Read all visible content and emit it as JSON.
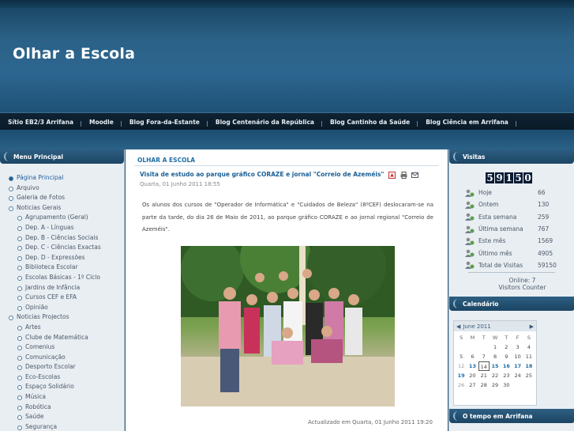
{
  "site": {
    "title": "Olhar a Escola"
  },
  "nav": [
    "Sítio EB2/3 Arrifana",
    "Moodle",
    "Blog Fora-da-Estante",
    "Blog Centenário da República",
    "Blog Cantinho da Saúde",
    "Blog Ciência em Arrifana"
  ],
  "left_menu": {
    "title": "Menu Principal",
    "items": [
      {
        "label": "Página Principal",
        "level": 0,
        "active": true
      },
      {
        "label": "Arquivo",
        "level": 0
      },
      {
        "label": "Galeria de Fotos",
        "level": 0
      },
      {
        "label": "Noticias Gerais",
        "level": 0
      },
      {
        "label": "Agrupamento (Geral)",
        "level": 1
      },
      {
        "label": "Dep. A - Línguas",
        "level": 1
      },
      {
        "label": "Dep. B - Ciências Sociais",
        "level": 1
      },
      {
        "label": "Dep. C - Ciências Exactas",
        "level": 1
      },
      {
        "label": "Dep. D - Expressões",
        "level": 1
      },
      {
        "label": "Biblioteca Escolar",
        "level": 1
      },
      {
        "label": "Escolas Básicas - 1º Ciclo",
        "level": 1
      },
      {
        "label": "Jardins de Infância",
        "level": 1
      },
      {
        "label": "Cursos CEF e EFA",
        "level": 1
      },
      {
        "label": "Opinião",
        "level": 1
      },
      {
        "label": "Noticias Projectos",
        "level": 0
      },
      {
        "label": "Artes",
        "level": 1
      },
      {
        "label": "Clube de Matemática",
        "level": 1
      },
      {
        "label": "Comenius",
        "level": 1
      },
      {
        "label": "Comunicação",
        "level": 1
      },
      {
        "label": "Desporto Escolar",
        "level": 1
      },
      {
        "label": "Eco-Escolas",
        "level": 1
      },
      {
        "label": "Espaço Solidário",
        "level": 1
      },
      {
        "label": "Música",
        "level": 1
      },
      {
        "label": "Robótica",
        "level": 1
      },
      {
        "label": "Saúde",
        "level": 1
      },
      {
        "label": "Segurança",
        "level": 1
      }
    ]
  },
  "main": {
    "section_title": "OLHAR A ESCOLA",
    "article_title": "Visita de estudo ao parque gráfico CORAZE e jornal \"Correio de Azeméis\"",
    "date": "Quarta, 01 Junho 2011 18:55",
    "body": "Os alunos dos cursos de \"Operador de Informática\" e \"Cuidados de Beleza\" (8ºCEF) deslocaram-se na parte da tarde, do dia 26 de Maio de 2011, ao parque gráfico CORAZE e ao jornal regional \"Correio de Azeméis\".",
    "updated": "Actualizado em Quarta, 01 Junho 2011 19:20",
    "icons": [
      "pdf-icon",
      "print-icon",
      "email-icon"
    ]
  },
  "visits": {
    "title": "Visitas",
    "counter_digits": [
      "5",
      "9",
      "1",
      "5",
      "0"
    ],
    "stats": [
      {
        "label": "Hoje",
        "value": "66"
      },
      {
        "label": "Ontem",
        "value": "130"
      },
      {
        "label": "Esta semana",
        "value": "259"
      },
      {
        "label": "Última semana",
        "value": "767"
      },
      {
        "label": "Este mês",
        "value": "1569"
      },
      {
        "label": "Último mês",
        "value": "4905"
      },
      {
        "label": "Total de Visitas",
        "value": "59150"
      }
    ],
    "online": "Online: 7",
    "counter_name": "Visitors Counter"
  },
  "calendar": {
    "title": "Calendário",
    "month": "June 2011",
    "dow": [
      "S",
      "M",
      "T",
      "W",
      "T",
      "F",
      "S"
    ],
    "days": [
      {
        "d": "",
        "c": ""
      },
      {
        "d": "",
        "c": ""
      },
      {
        "d": "",
        "c": ""
      },
      {
        "d": "1",
        "c": ""
      },
      {
        "d": "2",
        "c": ""
      },
      {
        "d": "3",
        "c": ""
      },
      {
        "d": "4",
        "c": ""
      },
      {
        "d": "5",
        "c": ""
      },
      {
        "d": "6",
        "c": ""
      },
      {
        "d": "7",
        "c": ""
      },
      {
        "d": "8",
        "c": ""
      },
      {
        "d": "9",
        "c": ""
      },
      {
        "d": "10",
        "c": ""
      },
      {
        "d": "11",
        "c": ""
      },
      {
        "d": "12",
        "c": "other"
      },
      {
        "d": "13",
        "c": "link"
      },
      {
        "d": "14",
        "c": "today"
      },
      {
        "d": "15",
        "c": "link"
      },
      {
        "d": "16",
        "c": "link"
      },
      {
        "d": "17",
        "c": "link"
      },
      {
        "d": "18",
        "c": "link"
      },
      {
        "d": "19",
        "c": "link"
      },
      {
        "d": "20",
        "c": ""
      },
      {
        "d": "21",
        "c": ""
      },
      {
        "d": "22",
        "c": ""
      },
      {
        "d": "23",
        "c": ""
      },
      {
        "d": "24",
        "c": ""
      },
      {
        "d": "25",
        "c": ""
      },
      {
        "d": "26",
        "c": "other"
      },
      {
        "d": "27",
        "c": ""
      },
      {
        "d": "28",
        "c": ""
      },
      {
        "d": "29",
        "c": ""
      },
      {
        "d": "30",
        "c": ""
      },
      {
        "d": "",
        "c": ""
      },
      {
        "d": "",
        "c": ""
      }
    ]
  },
  "tempo": {
    "title": "O tempo em Arrifana"
  }
}
